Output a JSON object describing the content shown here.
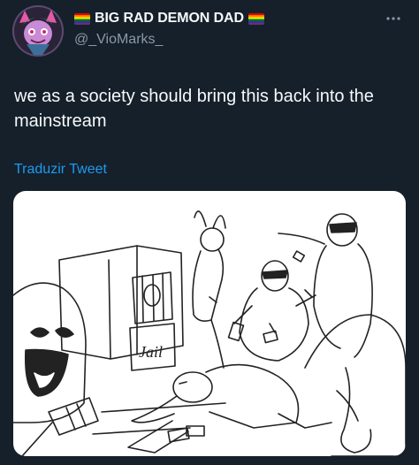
{
  "author": {
    "display_name": "BIG RAD DEMON DAD",
    "handle": "@_VioMarks_",
    "flag_icon": "rainbow-flag-icon"
  },
  "tweet": {
    "text": "we as a society should bring this back into the mainstream",
    "translate_label": "Traduzir Tweet"
  },
  "media": {
    "sign_text": "Jail"
  },
  "colors": {
    "background": "#15202b",
    "text": "#f7f9f9",
    "secondary_text": "#8b98a5",
    "link": "#1d9bf0"
  }
}
